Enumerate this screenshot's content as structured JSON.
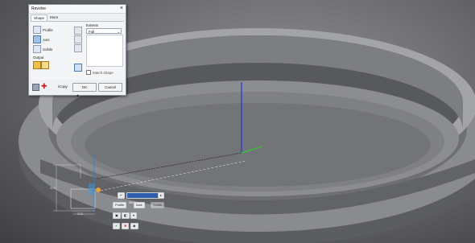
{
  "dialog": {
    "title": "Revolve",
    "close_icon": "close-icon",
    "tabs": [
      {
        "label": "Shape"
      },
      {
        "label": "More"
      }
    ],
    "shape": {
      "profile_label": "Profile",
      "axis_label": "Axis",
      "solids_label": "Solids",
      "output_label": "Output",
      "extents_label": "Extents",
      "extents_value": "Full",
      "match_shape_label": "Match shape"
    },
    "footer": {
      "icof_label": "iCopy",
      "ok_label": "OK",
      "cancel_label": "Cancel"
    }
  },
  "minitoolbar": {
    "value": "360",
    "profile_label": "Profile",
    "axis_label": "Axis",
    "solids_label": "Solids"
  },
  "dimensions": {
    "left_height": "22.5",
    "bottom_width": "22.5"
  },
  "colors": {
    "axis_blue": "#1f3fd6",
    "axis_green": "#2fcc2f",
    "accent_orange": "#f0a030"
  }
}
